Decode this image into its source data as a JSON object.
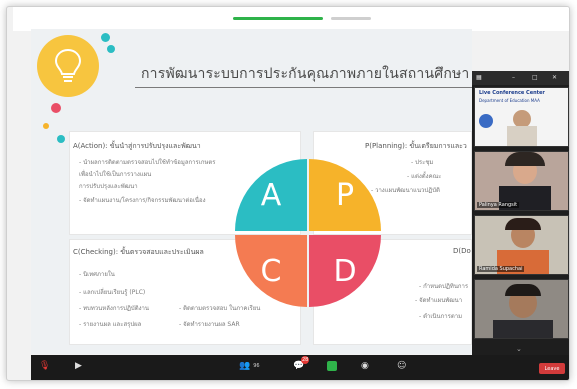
{
  "slide": {
    "title": "การพัฒนาระบบการประกันคุณภาพภายในสถานศึกษา",
    "quadrants": {
      "act": {
        "title": "A(Action): ขั้นนำสู่การปรับปรุงและพัฒนา",
        "items": [
          "- นำผลการติดตามตรวจสอบไปใช้ทำข้อมูลการเกษตร",
          "เพื่อนำไปใช้เป็นการวางแผน",
          "การปรับปรุงและพัฒนา",
          "- จัดทำแผนงาน/โครงการ/กิจกรรมพัฒนาต่อเนื่อง"
        ]
      },
      "plan": {
        "title": "P(Planning): ขั้นเตรียมการและว",
        "items": [
          "- ประชุม",
          "- แต่งตั้งคณะ",
          "- วางแผนพัฒนาแนวปฏิบัติ"
        ]
      },
      "check": {
        "title": "C(Checking): ขั้นตรวจสอบและประเมินผล",
        "items": [
          "- นิเทศภายใน",
          "- แลกเปลี่ยนเรียนรู้ (PLC)",
          "- ทบทวนหลังการปฏิบัติงาน",
          "- รายงานผล และสรุปผล",
          "- ติดตามตรวจสอบ ในภาคเรียน",
          "- จัดทำรายงานผล SAR"
        ]
      },
      "do": {
        "title": "D(Do",
        "items": [
          "- กำหนดปฏิทินการ",
          "- จัดทำแผนพัฒนา",
          "- ดำเนินการตาม"
        ]
      }
    },
    "petals": {
      "a": "A",
      "p": "P",
      "c": "C",
      "d": "D"
    },
    "colors": {
      "a": "#2bbdc3",
      "p": "#f6b32a",
      "c": "#f47b52",
      "d": "#e94e66"
    }
  },
  "participants": {
    "tiles": [
      {
        "name": "Live Conference Center",
        "sub": "Department of Education MAA"
      },
      {
        "name": "Palinya Rangsit"
      },
      {
        "name": "Ramida Supachai"
      },
      {
        "name": ""
      }
    ]
  },
  "toolbar": {
    "mute": "Mute",
    "video": "Stop Video",
    "participants_count": "96",
    "chat_badge": "28",
    "leave": "Leave"
  }
}
